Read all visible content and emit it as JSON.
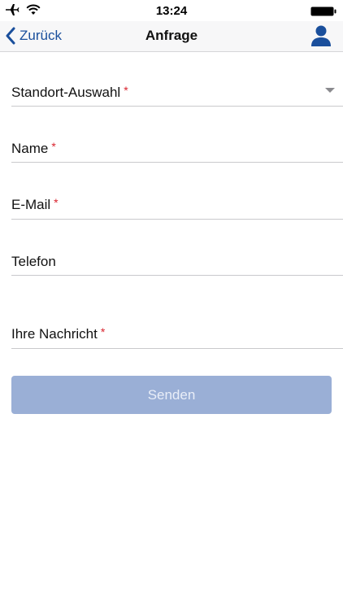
{
  "status_bar": {
    "time": "13:24",
    "icons": [
      "airplane-icon",
      "wifi-icon",
      "battery-icon"
    ]
  },
  "nav": {
    "back_label": "Zurück",
    "title": "Anfrage",
    "right_icon": "user-icon"
  },
  "form": {
    "fields": [
      {
        "label": "Standort-Auswahl",
        "required": "*",
        "type": "dropdown"
      },
      {
        "label": "Name",
        "required": "*",
        "type": "text"
      },
      {
        "label": "E-Mail",
        "required": "*",
        "type": "email"
      },
      {
        "label": "Telefon",
        "required": "",
        "type": "tel"
      },
      {
        "label": "Ihre Nachricht",
        "required": "*",
        "type": "textarea"
      }
    ],
    "submit_label": "Senden"
  },
  "colors": {
    "accent": "#1a4f9c",
    "required": "#d9232e",
    "button_disabled": "#9aafd6"
  }
}
